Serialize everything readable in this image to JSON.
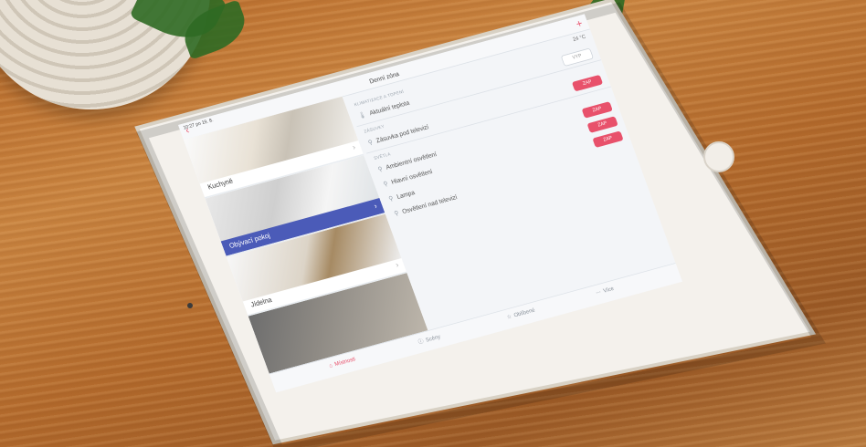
{
  "status": {
    "time": "10:27 po 19. 8."
  },
  "nav": {
    "title": "Denní zóna",
    "add_label": "+"
  },
  "temperature": "24 °C",
  "rooms": [
    {
      "label": "Kuchyně"
    },
    {
      "label": "Obývací pokoj",
      "active": true
    },
    {
      "label": "Jídelna"
    },
    {
      "label": ""
    }
  ],
  "sections": {
    "thermostat": {
      "title": "KLIMATIZACE A TOPENÍ",
      "items": [
        {
          "label": "Aktuální teplota",
          "button": "VYP"
        }
      ]
    },
    "sockets": {
      "title": "ZÁSUVKY",
      "items": [
        {
          "label": "Zásuvka pod televizí",
          "button": "ZAP"
        }
      ]
    },
    "lights": {
      "title": "SVĚTLA",
      "items": [
        {
          "label": "Ambientní osvětlení",
          "button": "ZAP"
        },
        {
          "label": "Hlavní osvětlení",
          "button": "ZAP"
        },
        {
          "label": "Lampa",
          "button": "ZAP"
        },
        {
          "label": "Osvětlení nad televizí",
          "button": ""
        }
      ]
    }
  },
  "tabbar": {
    "tabs": [
      {
        "label": "Místnosti",
        "icon": "home-icon"
      },
      {
        "label": "Scény",
        "icon": "info-icon"
      },
      {
        "label": "Oblíbené",
        "icon": "star-icon"
      },
      {
        "label": "Více",
        "icon": "more-icon"
      }
    ]
  },
  "colors": {
    "accent": "#e8516b",
    "active_room": "#4b5bb8",
    "wood": "#c07a38"
  }
}
